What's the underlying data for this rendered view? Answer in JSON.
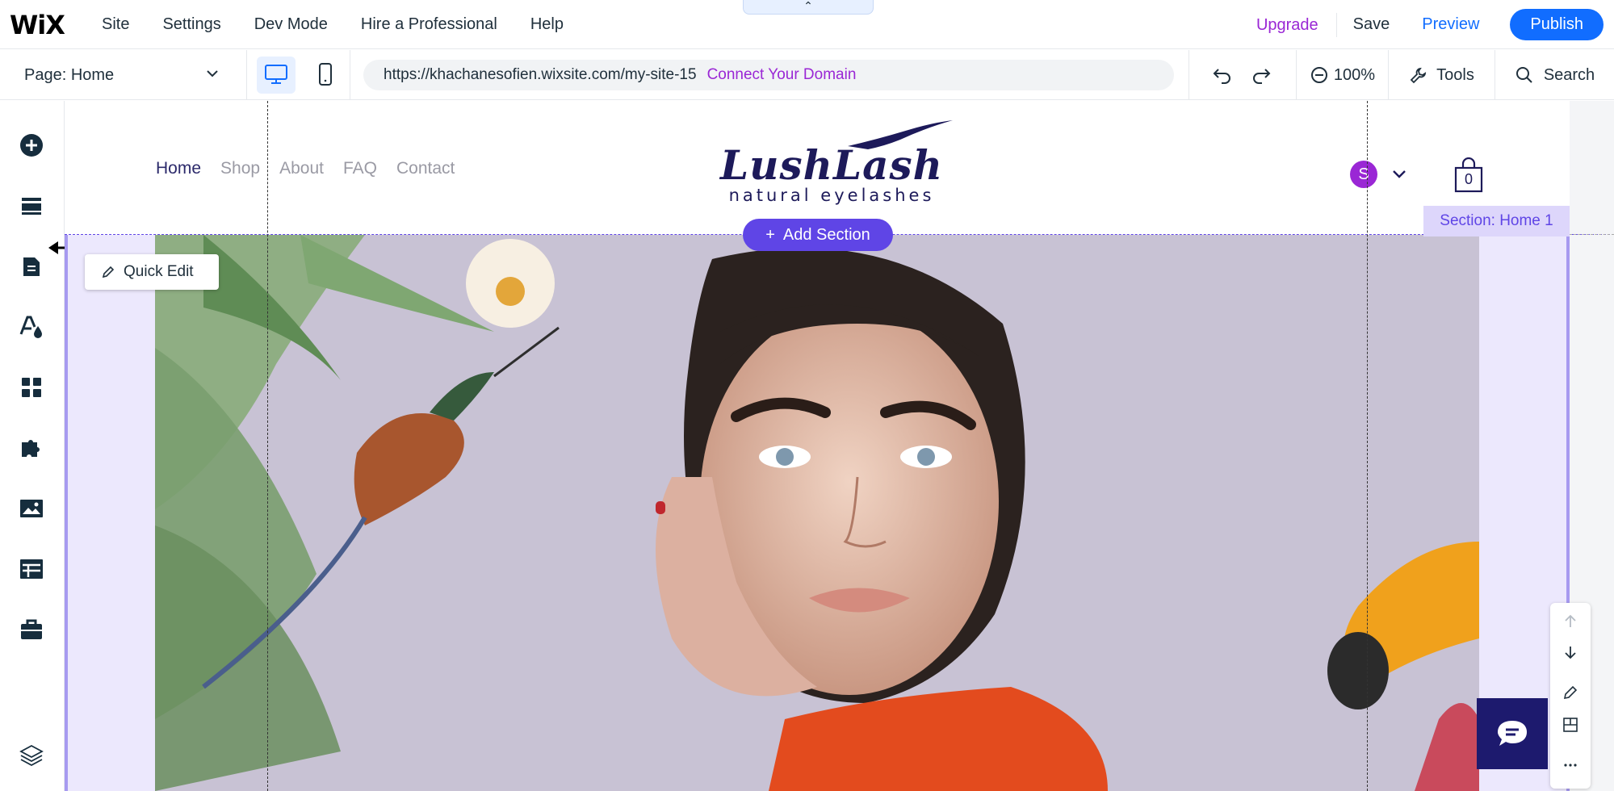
{
  "topbar": {
    "logo": "WiX",
    "menu": [
      "Site",
      "Settings",
      "Dev Mode",
      "Hire a Professional",
      "Help"
    ],
    "upgrade": "Upgrade",
    "save": "Save",
    "preview": "Preview",
    "publish": "Publish"
  },
  "bar2": {
    "page_selector": "Page: Home",
    "url": "https://khachanesofien.wixsite.com/my-site-15",
    "connect_domain": "Connect Your Domain",
    "zoom": "100%",
    "tools": "Tools",
    "search": "Search"
  },
  "leftrail": {
    "icons": [
      "add-elements-icon",
      "sections-icon",
      "pages-icon",
      "site-design-icon",
      "app-market-icon",
      "business-apps-icon",
      "media-icon",
      "cms-icon",
      "portfolio-icon",
      "layers-icon"
    ]
  },
  "site": {
    "nav": [
      "Home",
      "Shop",
      "About",
      "FAQ",
      "Contact"
    ],
    "brand_script": "LushLash",
    "brand_sub": "natural eyelashes",
    "avatar_initial": "S",
    "cart_count": "0",
    "add_section": "Add Section",
    "section_label": "Section: Home 1",
    "quick_edit": "Quick Edit"
  },
  "colors": {
    "accent_blue": "#116dff",
    "upgrade_purple": "#9a27d5",
    "editor_violet": "#5f45e6",
    "brand_navy": "#1d1a5a"
  }
}
